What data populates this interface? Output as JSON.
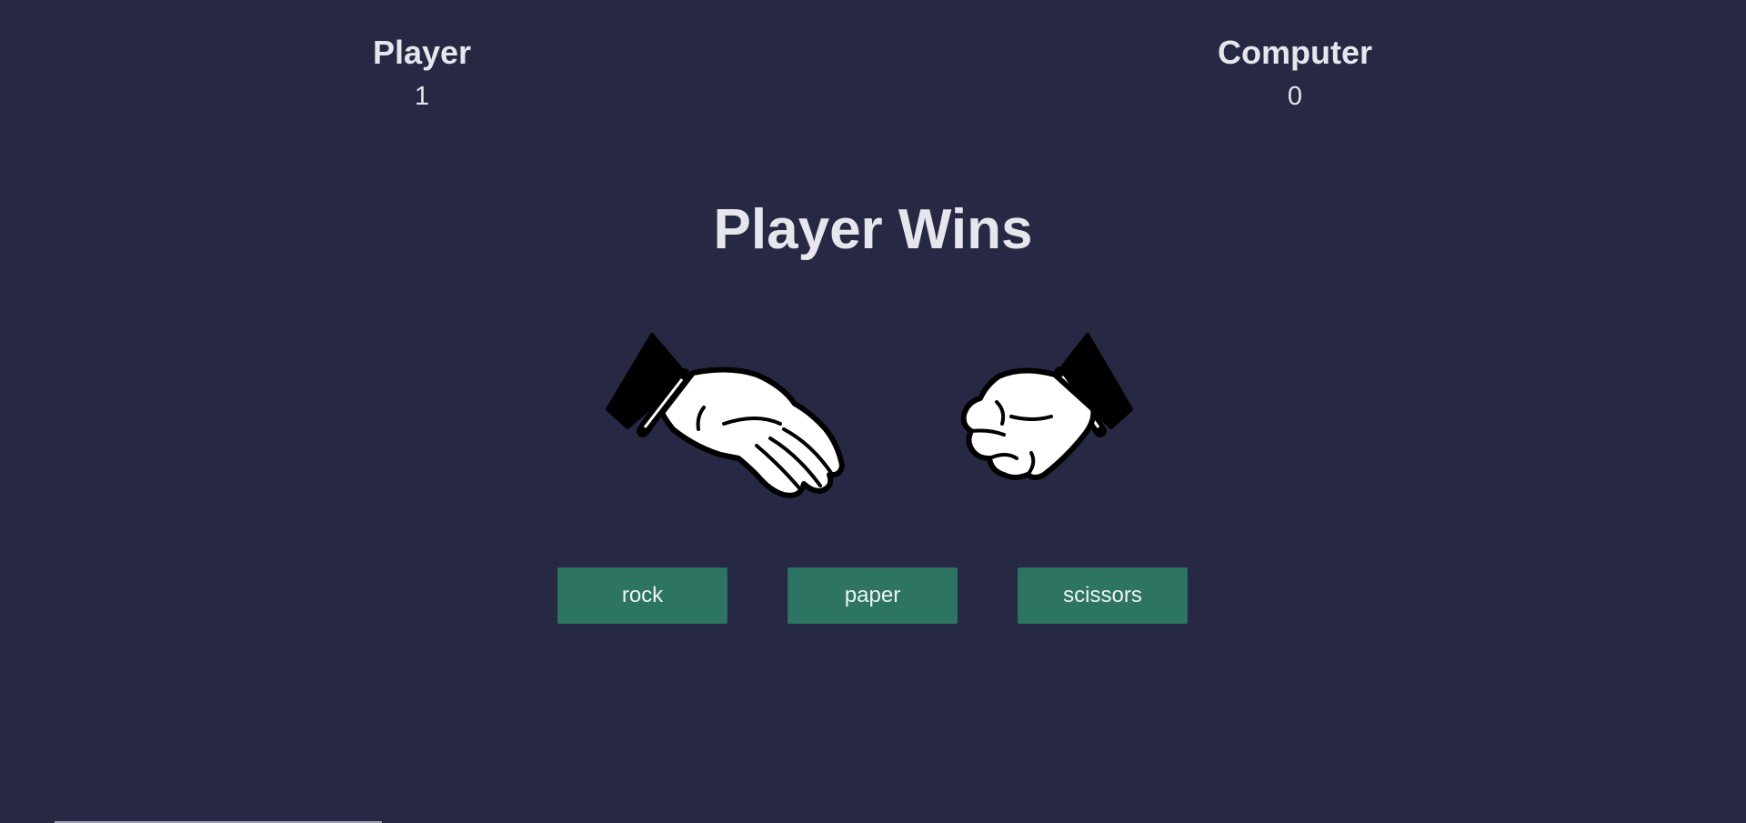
{
  "scoreboard": {
    "player": {
      "label": "Player",
      "score": "1"
    },
    "computer": {
      "label": "Computer",
      "score": "0"
    }
  },
  "result": {
    "text": "Player Wins"
  },
  "hands": {
    "player": {
      "icon": "paper-hand-icon"
    },
    "computer": {
      "icon": "rock-hand-icon"
    }
  },
  "controls": {
    "rock_label": "rock",
    "paper_label": "paper",
    "scissors_label": "scissors"
  },
  "colors": {
    "background": "#272944",
    "button": "#2d7562",
    "text": "#e6e6ec"
  }
}
